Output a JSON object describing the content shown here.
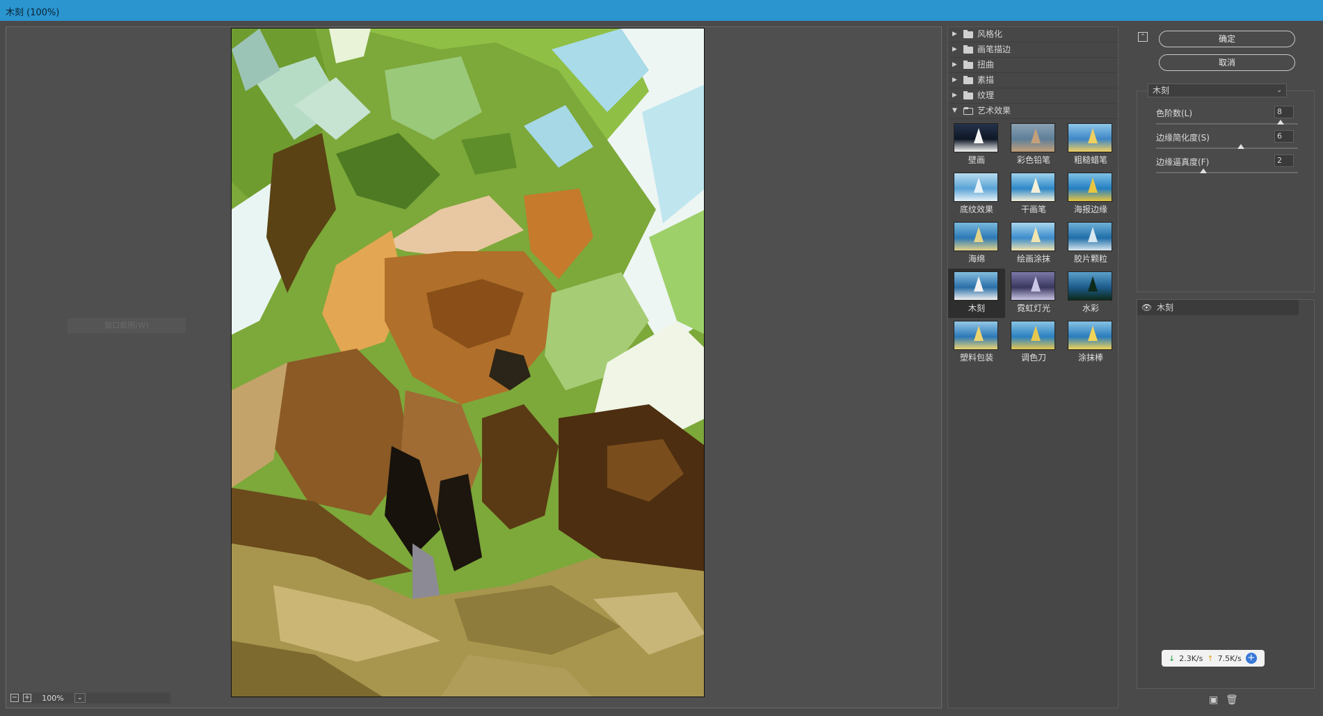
{
  "window": {
    "title": "木刻 (100%)"
  },
  "preview": {
    "ghost_label": "窗口截图(W)",
    "zoom": {
      "value": "100%",
      "minus_symbol": "−",
      "plus_symbol": "+",
      "dropdown_symbol": "⌄"
    }
  },
  "gallery": {
    "folders": [
      {
        "label": "风格化",
        "expanded": false
      },
      {
        "label": "画笔描边",
        "expanded": false
      },
      {
        "label": "扭曲",
        "expanded": false
      },
      {
        "label": "素描",
        "expanded": false
      },
      {
        "label": "纹理",
        "expanded": false
      },
      {
        "label": "艺术效果",
        "expanded": true
      }
    ],
    "effects": [
      {
        "label": "壁画",
        "selected": false
      },
      {
        "label": "彩色铅笔",
        "selected": false
      },
      {
        "label": "粗糙蜡笔",
        "selected": false
      },
      {
        "label": "底纹效果",
        "selected": false
      },
      {
        "label": "干画笔",
        "selected": false
      },
      {
        "label": "海报边缘",
        "selected": false
      },
      {
        "label": "海绵",
        "selected": false
      },
      {
        "label": "绘画涂抹",
        "selected": false
      },
      {
        "label": "胶片颗粒",
        "selected": false
      },
      {
        "label": "木刻",
        "selected": true
      },
      {
        "label": "霓虹灯光",
        "selected": false
      },
      {
        "label": "水彩",
        "selected": false
      },
      {
        "label": "塑料包装",
        "selected": false
      },
      {
        "label": "调色刀",
        "selected": false
      },
      {
        "label": "涂抹棒",
        "selected": false
      }
    ]
  },
  "settings": {
    "ok_label": "确定",
    "cancel_label": "取消",
    "filter_name": "木刻",
    "params": [
      {
        "label": "色阶数(L)",
        "value": "8",
        "fraction": 0.875
      },
      {
        "label": "边缘简化度(S)",
        "value": "6",
        "fraction": 0.6
      },
      {
        "label": "边缘逼真度(F)",
        "value": "2",
        "fraction": 0.333
      }
    ],
    "layer_label": "木刻"
  },
  "network": {
    "down": "2.3K/s",
    "up": "7.5K/s",
    "down_arrow": "↓",
    "up_arrow": "↑",
    "plus": "+"
  },
  "colors": {
    "titlebar": "#2a95cf",
    "panel": "#4a4a4a"
  }
}
